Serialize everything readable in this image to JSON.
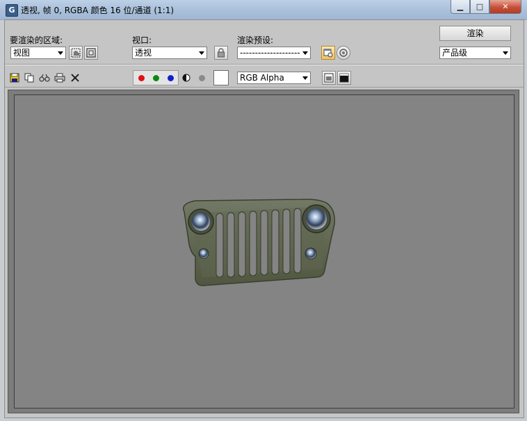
{
  "window": {
    "title": "透视, 帧 0, RGBA 颜色 16 位/通道 (1:1)",
    "app_icon_letter": "G",
    "minimize_glyph": "▁",
    "maximize_glyph": "□",
    "close_glyph": "✕"
  },
  "render_area": {
    "label": "要渲染的区域:",
    "value": "视图"
  },
  "viewport": {
    "label": "视口:",
    "value": "透视"
  },
  "preset": {
    "label": "渲染预设:",
    "value": "--------------------"
  },
  "render_button": {
    "label": "渲染"
  },
  "quality": {
    "value": "产品级"
  },
  "channel": {
    "value": "RGB Alpha"
  },
  "colors": {
    "red": "#e01010",
    "green": "#0a8a0a",
    "blue": "#1020d0",
    "background": "#848484",
    "grille": "#5e6450"
  }
}
